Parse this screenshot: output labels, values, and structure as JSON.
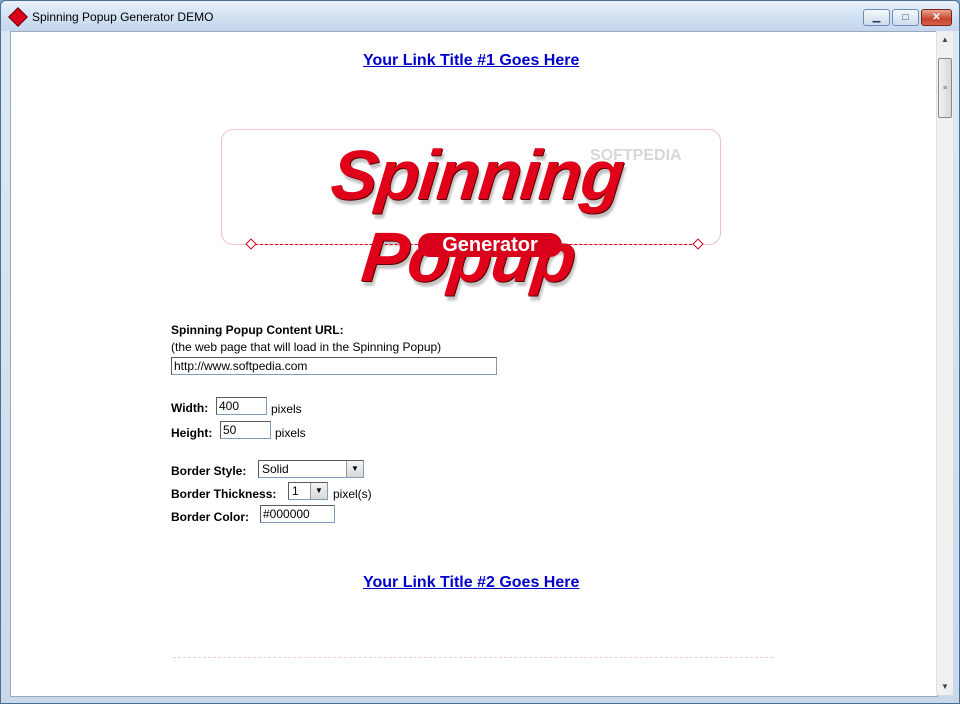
{
  "window": {
    "title": "Spinning Popup Generator DEMO",
    "min": "▁",
    "max": "□",
    "close": "✕"
  },
  "links": {
    "link1": "Your Link Title #1 Goes Here",
    "link2": "Your Link Title #2 Goes Here"
  },
  "logo": {
    "main": "Spinning Popup",
    "badge": "Generator",
    "watermark": "SOFTPEDIA"
  },
  "form": {
    "url_label": "Spinning Popup Content URL:",
    "url_hint": "(the web page that will load in the Spinning Popup)",
    "url_value": "http://www.softpedia.com",
    "width_label": "Width:",
    "width_value": "400",
    "width_unit": "pixels",
    "height_label": "Height:",
    "height_value": "50",
    "height_unit": "pixels",
    "border_style_label": "Border Style:",
    "border_style_value": "Solid",
    "border_thickness_label": "Border Thickness:",
    "border_thickness_value": "1",
    "border_thickness_unit": "pixel(s)",
    "border_color_label": "Border Color:",
    "border_color_value": "#000000"
  },
  "scrollbar": {
    "up": "▲",
    "down": "▼",
    "grip": "≡"
  },
  "colors": {
    "brand_red": "#d9001b",
    "link_blue": "#0000cc"
  }
}
